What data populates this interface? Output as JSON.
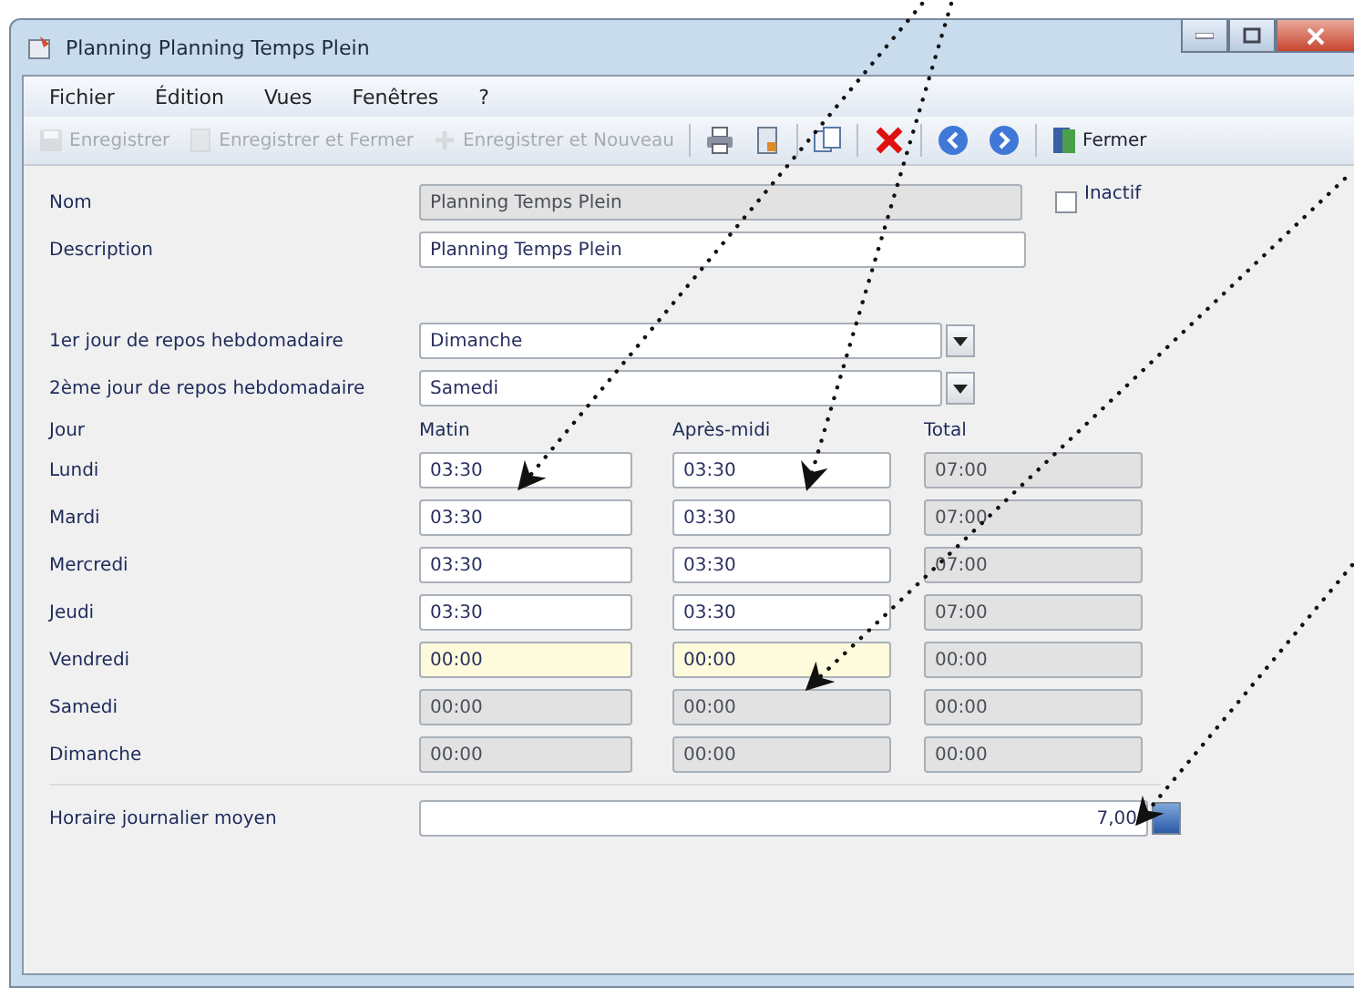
{
  "window": {
    "title": "Planning Planning Temps Plein"
  },
  "menu": [
    "Fichier",
    "Édition",
    "Vues",
    "Fenêtres",
    "?"
  ],
  "toolbar": [
    {
      "kind": "save",
      "label": "Enregistrer",
      "disabled": true
    },
    {
      "kind": "saveclose",
      "label": "Enregistrer et Fermer",
      "disabled": true
    },
    {
      "kind": "savenew",
      "label": "Enregistrer et Nouveau",
      "disabled": true
    },
    {
      "kind": "sep"
    },
    {
      "kind": "print",
      "disabled": false
    },
    {
      "kind": "export",
      "disabled": false
    },
    {
      "kind": "sep"
    },
    {
      "kind": "copy",
      "disabled": false
    },
    {
      "kind": "sep"
    },
    {
      "kind": "delete",
      "disabled": false
    },
    {
      "kind": "sep"
    },
    {
      "kind": "back",
      "disabled": false
    },
    {
      "kind": "forward",
      "disabled": false
    },
    {
      "kind": "sep"
    },
    {
      "kind": "close",
      "label": "Fermer",
      "disabled": false
    }
  ],
  "form": {
    "name_label": "Nom",
    "name_value": "Planning Temps Plein",
    "inactive_label": "Inactif",
    "inactive_checked": false,
    "description_label": "Description",
    "description_value": "Planning Temps Plein",
    "rest_days": [
      {
        "label": "1er jour de repos hebdomadaire",
        "value": "Dimanche"
      },
      {
        "label": "2ème jour de repos hebdomadaire",
        "value": "Samedi"
      }
    ]
  },
  "schedule": {
    "day_header": "Jour",
    "columns": [
      "Matin",
      "Après-midi",
      "Total"
    ],
    "rows": [
      {
        "day": "Lundi",
        "cells": [
          {
            "value": "03:30",
            "disabled": false,
            "focused": false
          },
          {
            "value": "03:30",
            "disabled": false,
            "focused": false
          },
          {
            "value": "07:00",
            "disabled": true,
            "focused": false
          }
        ]
      },
      {
        "day": "Mardi",
        "cells": [
          {
            "value": "03:30",
            "disabled": false,
            "focused": false
          },
          {
            "value": "03:30",
            "disabled": false,
            "focused": false
          },
          {
            "value": "07:00",
            "disabled": true,
            "focused": false
          }
        ]
      },
      {
        "day": "Mercredi",
        "cells": [
          {
            "value": "03:30",
            "disabled": false,
            "focused": false
          },
          {
            "value": "03:30",
            "disabled": false,
            "focused": false
          },
          {
            "value": "07:00",
            "disabled": true,
            "focused": false
          }
        ]
      },
      {
        "day": "Jeudi",
        "cells": [
          {
            "value": "03:30",
            "disabled": false,
            "focused": false
          },
          {
            "value": "03:30",
            "disabled": false,
            "focused": false
          },
          {
            "value": "07:00",
            "disabled": true,
            "focused": false
          }
        ]
      },
      {
        "day": "Vendredi",
        "cells": [
          {
            "value": "00:00",
            "disabled": false,
            "focused": true
          },
          {
            "value": "00:00",
            "disabled": false,
            "focused": true
          },
          {
            "value": "00:00",
            "disabled": true,
            "focused": false
          }
        ]
      },
      {
        "day": "Samedi",
        "cells": [
          {
            "value": "00:00",
            "disabled": true,
            "focused": false
          },
          {
            "value": "00:00",
            "disabled": true,
            "focused": false
          },
          {
            "value": "00:00",
            "disabled": true,
            "focused": false
          }
        ]
      },
      {
        "day": "Dimanche",
        "cells": [
          {
            "value": "00:00",
            "disabled": true,
            "focused": false
          },
          {
            "value": "00:00",
            "disabled": true,
            "focused": false
          },
          {
            "value": "00:00",
            "disabled": true,
            "focused": false
          }
        ]
      }
    ]
  },
  "average": {
    "label": "Horaire journalier moyen",
    "value": "7,00"
  }
}
